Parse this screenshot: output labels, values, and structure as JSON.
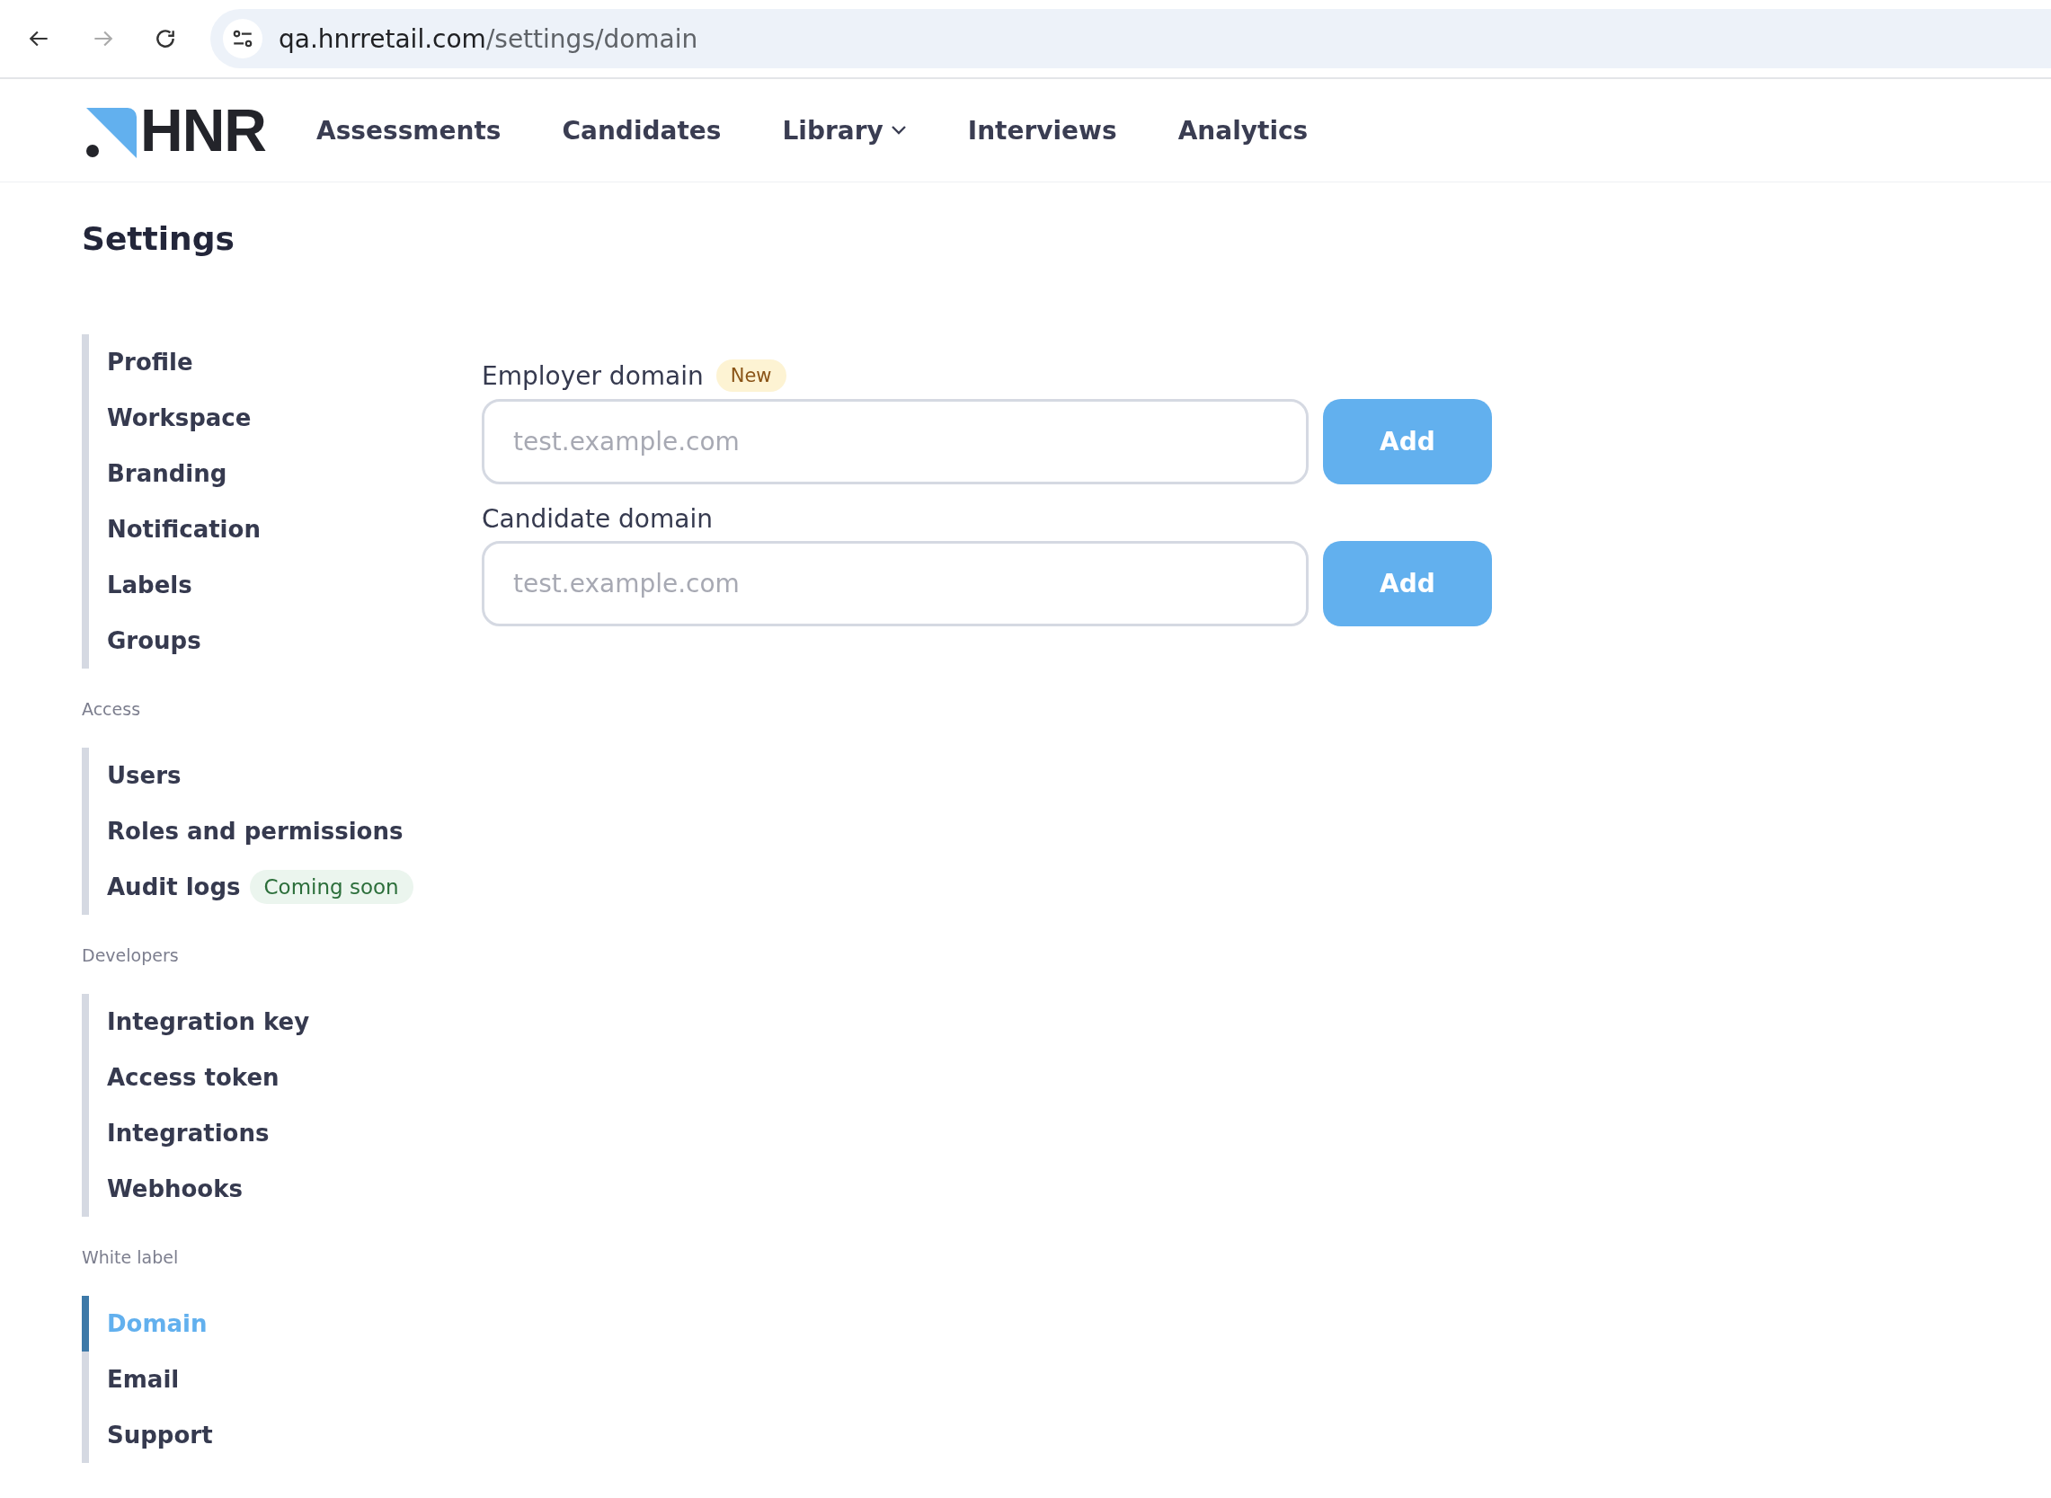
{
  "browser": {
    "url_host": "qa.hnrretail.com",
    "url_path": "/settings/domain"
  },
  "nav": {
    "logo": "HNR",
    "items": [
      {
        "label": "Assessments",
        "dropdown": false
      },
      {
        "label": "Candidates",
        "dropdown": false
      },
      {
        "label": "Library",
        "dropdown": true
      },
      {
        "label": "Interviews",
        "dropdown": false
      },
      {
        "label": "Analytics",
        "dropdown": false
      }
    ]
  },
  "page_title": "Settings",
  "sidebar": {
    "sections": [
      {
        "items": [
          {
            "label": "Profile",
            "selected": false
          },
          {
            "label": "Workspace",
            "selected": false
          },
          {
            "label": "Branding",
            "selected": false
          },
          {
            "label": "Notification",
            "selected": false
          },
          {
            "label": "Labels",
            "selected": false
          },
          {
            "label": "Groups",
            "selected": false
          }
        ]
      },
      {
        "heading": "Access",
        "items": [
          {
            "label": "Users",
            "selected": false
          },
          {
            "label": "Roles and permissions",
            "selected": false
          },
          {
            "label": "Audit logs",
            "selected": false,
            "badge": "Coming soon"
          }
        ]
      },
      {
        "heading": "Developers",
        "items": [
          {
            "label": "Integration key",
            "selected": false
          },
          {
            "label": "Access token",
            "selected": false
          },
          {
            "label": "Integrations",
            "selected": false
          },
          {
            "label": "Webhooks",
            "selected": false
          }
        ]
      },
      {
        "heading": "White label",
        "items": [
          {
            "label": "Domain",
            "selected": true
          },
          {
            "label": "Email",
            "selected": false
          },
          {
            "label": "Support",
            "selected": false
          }
        ]
      }
    ]
  },
  "fields": [
    {
      "label": "Employer domain",
      "badge": "New",
      "placeholder": "test.example.com",
      "button": "Add"
    },
    {
      "label": "Candidate domain",
      "placeholder": "test.example.com",
      "button": "Add"
    }
  ]
}
